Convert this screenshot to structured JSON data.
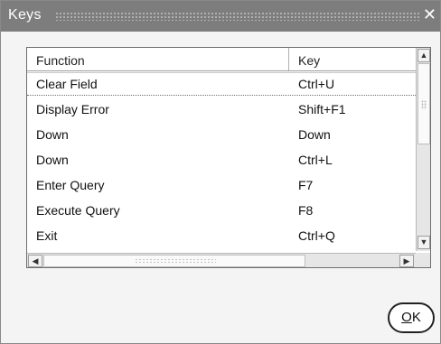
{
  "window": {
    "title": "Keys",
    "close_glyph": "✕"
  },
  "table": {
    "headers": {
      "function": "Function",
      "key": "Key"
    },
    "rows": [
      {
        "function": "Clear Field",
        "key": "Ctrl+U",
        "selected": true
      },
      {
        "function": "Display Error",
        "key": "Shift+F1"
      },
      {
        "function": "Down",
        "key": "Down"
      },
      {
        "function": "Down",
        "key": "Ctrl+L"
      },
      {
        "function": "Enter Query",
        "key": "F7"
      },
      {
        "function": "Execute Query",
        "key": "F8"
      },
      {
        "function": "Exit",
        "key": "Ctrl+Q"
      }
    ]
  },
  "scrollbars": {
    "up_glyph": "▲",
    "down_glyph": "▼",
    "left_glyph": "◀",
    "right_glyph": "▶"
  },
  "buttons": {
    "ok_mnemonic": "O",
    "ok_rest": "K"
  }
}
